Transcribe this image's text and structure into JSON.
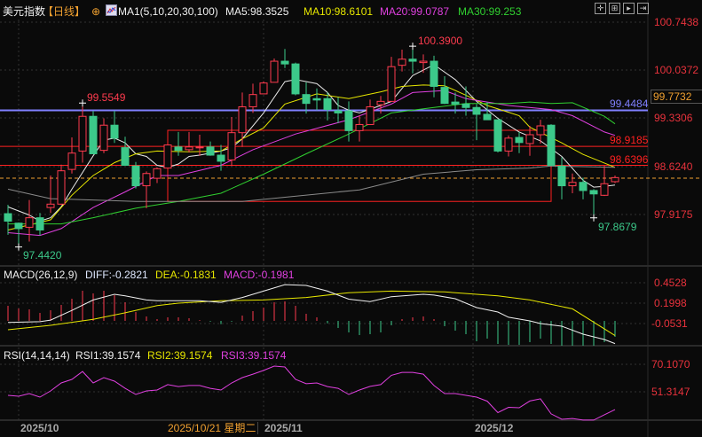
{
  "header": {
    "symbol": "美元指数",
    "period": "【日线】",
    "ma_params": "MA1(5,10,20,30,100)",
    "ma5": "MA5:98.3525",
    "ma10": "MA10:98.6101",
    "ma20": "MA20:99.0787",
    "ma30": "MA30:99.253"
  },
  "macd_header": {
    "params": "MACD(26,12,9)",
    "diff": "DIFF:-0.2821",
    "dea": "DEA:-0.1831",
    "macd": "MACD:-0.1981"
  },
  "rsi_header": {
    "params": "RSI(14,14,14)",
    "rsi1": "RSI1:39.1574",
    "rsi2": "RSI2:39.1574",
    "rsi3": "RSI3:39.1574"
  },
  "toolbar": {
    "icons": [
      "crosshair-icon",
      "zoom-in-icon",
      "play-icon",
      "move-right-icon"
    ]
  },
  "price_axis": [
    "100.7438",
    "100.0372",
    "99.3306",
    "98.6240",
    "97.9175"
  ],
  "crosshair_price": "99.7732",
  "crosshair_date": "2025/10/21 星期二",
  "macd_axis": [
    "0.4528",
    "0.1998",
    "-0.0531"
  ],
  "rsi_axis": [
    "70.1070",
    "51.3147"
  ],
  "date_axis": [
    "2025/10",
    "2025/11",
    "2025/12"
  ],
  "annotations": {
    "high": "100.3900",
    "local_high": "99.5549",
    "low": "97.4420",
    "recent_low": "97.8679"
  },
  "hlines": {
    "blue": "99.4484",
    "red1": "98.9185",
    "red2": "98.6396"
  },
  "colors": {
    "up": "#ff3b4e",
    "down": "#3cc98a",
    "ma5": "#e8e8e8",
    "ma10": "#e6e600",
    "ma20": "#e040e0",
    "ma30": "#30d030",
    "ma100": "#8a8a8a",
    "blue_line": "#8080ff",
    "axis_text": "#e8323c",
    "crosshair": "#f0a030"
  },
  "chart_data": {
    "type": "candlestick",
    "price_range": [
      97.9175,
      100.7438
    ],
    "candles": [
      [
        97.93,
        98.06,
        97.62,
        97.82
      ],
      [
        97.79,
        97.8,
        97.44,
        97.71
      ],
      [
        97.73,
        98.13,
        97.52,
        97.87
      ],
      [
        97.87,
        97.94,
        97.61,
        97.69
      ],
      [
        98.02,
        98.49,
        97.94,
        98.07
      ],
      [
        98.07,
        98.65,
        98.06,
        98.56
      ],
      [
        98.58,
        99.05,
        98.52,
        98.82
      ],
      [
        98.85,
        99.5549,
        98.68,
        99.36
      ],
      [
        99.36,
        99.44,
        98.81,
        98.81
      ],
      [
        98.86,
        99.33,
        98.82,
        99.23
      ],
      [
        99.23,
        99.44,
        98.97,
        99.04
      ],
      [
        98.9,
        99.06,
        98.64,
        98.64
      ],
      [
        98.63,
        98.69,
        98.3,
        98.34
      ],
      [
        98.34,
        98.55,
        98.01,
        98.52
      ],
      [
        98.45,
        98.61,
        98.38,
        98.59
      ],
      [
        98.6,
        98.94,
        98.6,
        98.94
      ],
      [
        98.91,
        99.13,
        98.78,
        98.86
      ],
      [
        98.87,
        99.13,
        98.83,
        98.91
      ],
      [
        98.9,
        99.09,
        98.78,
        98.91
      ],
      [
        98.91,
        98.99,
        98.78,
        98.79
      ],
      [
        98.79,
        98.94,
        98.56,
        98.7
      ],
      [
        98.72,
        99.35,
        98.63,
        99.12
      ],
      [
        99.12,
        99.71,
        98.91,
        99.5
      ],
      [
        99.5,
        99.84,
        99.41,
        99.68
      ],
      [
        99.69,
        99.875,
        99.69,
        99.85
      ],
      [
        99.86,
        100.21,
        99.86,
        100.17
      ],
      [
        100.17,
        100.35,
        100.07,
        100.13
      ],
      [
        100.13,
        100.15,
        99.67,
        99.69
      ],
      [
        99.68,
        99.86,
        99.4,
        99.55
      ],
      [
        99.62,
        99.77,
        99.45,
        99.6
      ],
      [
        99.62,
        99.71,
        99.3,
        99.46
      ],
      [
        99.44,
        99.64,
        99.26,
        99.41
      ],
      [
        99.44,
        99.58,
        98.99,
        99.15
      ],
      [
        99.15,
        99.37,
        98.99,
        99.24
      ],
      [
        99.24,
        99.605,
        99.24,
        99.5
      ],
      [
        99.53,
        99.66,
        99.4,
        99.58
      ],
      [
        99.58,
        100.235,
        99.58,
        100.09
      ],
      [
        100.11,
        100.34,
        100.02,
        100.2
      ],
      [
        100.2,
        100.39,
        99.99,
        100.17
      ],
      [
        100.15,
        100.27,
        100.0,
        100.17
      ],
      [
        100.17,
        100.25,
        99.64,
        99.8
      ],
      [
        99.785,
        99.95,
        99.54,
        99.55
      ],
      [
        99.57,
        99.71,
        99.4,
        99.54
      ],
      [
        99.54,
        99.8,
        99.37,
        99.49
      ],
      [
        99.49,
        99.54,
        99.01,
        99.39
      ],
      [
        99.39,
        99.57,
        99.31,
        99.31
      ],
      [
        99.31,
        99.31,
        98.83,
        98.85
      ],
      [
        98.85,
        99.08,
        98.77,
        99.04
      ],
      [
        99.05,
        99.13,
        98.82,
        98.975
      ],
      [
        98.96,
        99.22,
        98.78,
        99.09
      ],
      [
        99.09,
        99.31,
        98.96,
        99.22
      ],
      [
        99.23,
        99.245,
        98.64,
        98.64
      ],
      [
        98.63,
        98.76,
        98.14,
        98.34
      ],
      [
        98.34,
        98.52,
        98.23,
        98.39
      ],
      [
        98.39,
        98.46,
        98.14,
        98.27
      ],
      [
        98.27,
        98.29,
        97.8679,
        98.22
      ],
      [
        98.2,
        98.63,
        98.19,
        98.37
      ],
      [
        98.4,
        98.49,
        98.38,
        98.46
      ]
    ],
    "candle_fields": [
      "open",
      "high",
      "low",
      "close"
    ],
    "ma": [
      {
        "name": "MA5",
        "color": "#e8e8e8",
        "points": [
          [
            0,
            98.03
          ],
          [
            2,
            97.91
          ],
          [
            3,
            97.82
          ],
          [
            4,
            97.87
          ],
          [
            5,
            98.03
          ],
          [
            6,
            98.29
          ],
          [
            8,
            98.78
          ],
          [
            9,
            99.01
          ],
          [
            10,
            99.04
          ],
          [
            11,
            98.97
          ],
          [
            12,
            98.81
          ],
          [
            13,
            98.77
          ],
          [
            14,
            98.64
          ],
          [
            15,
            98.61
          ],
          [
            16,
            98.66
          ],
          [
            17,
            98.77
          ],
          [
            18,
            98.79
          ],
          [
            20,
            98.85
          ],
          [
            21,
            98.9
          ],
          [
            22,
            99.03
          ],
          [
            24,
            99.41
          ],
          [
            26,
            99.87
          ],
          [
            27,
            99.9
          ],
          [
            29,
            99.84
          ],
          [
            30,
            99.71
          ],
          [
            31,
            99.52
          ],
          [
            32,
            99.45
          ],
          [
            33,
            99.41
          ],
          [
            35,
            99.52
          ],
          [
            36,
            99.58
          ],
          [
            38,
            99.96
          ],
          [
            40,
            100.12
          ],
          [
            42,
            99.9
          ],
          [
            44,
            99.58
          ],
          [
            46,
            99.33
          ],
          [
            48,
            99.13
          ],
          [
            50,
            99.0
          ],
          [
            52,
            98.77
          ],
          [
            54,
            98.42
          ],
          [
            55,
            98.32
          ],
          [
            56,
            98.33
          ],
          [
            57,
            98.35
          ]
        ]
      },
      {
        "name": "MA10",
        "color": "#e6e600",
        "points": [
          [
            0,
            97.69
          ],
          [
            4,
            97.84
          ],
          [
            6,
            98.2
          ],
          [
            8,
            98.49
          ],
          [
            10,
            98.68
          ],
          [
            12,
            98.81
          ],
          [
            14,
            98.85
          ],
          [
            17,
            98.84
          ],
          [
            20,
            98.85
          ],
          [
            22,
            99.03
          ],
          [
            24,
            99.19
          ],
          [
            26,
            99.54
          ],
          [
            29,
            99.69
          ],
          [
            32,
            99.62
          ],
          [
            35,
            99.72
          ],
          [
            37,
            99.8
          ],
          [
            39,
            99.82
          ],
          [
            41,
            99.81
          ],
          [
            43,
            99.67
          ],
          [
            45,
            99.52
          ],
          [
            48,
            99.37
          ],
          [
            49,
            99.2
          ],
          [
            52,
            98.97
          ],
          [
            54,
            98.8
          ],
          [
            57,
            98.61
          ]
        ]
      },
      {
        "name": "MA20",
        "color": "#e040e0",
        "points": [
          [
            0,
            97.65
          ],
          [
            3,
            97.61
          ],
          [
            5,
            97.71
          ],
          [
            8,
            98.02
          ],
          [
            11,
            98.25
          ],
          [
            14,
            98.49
          ],
          [
            16,
            98.49
          ],
          [
            20,
            98.64
          ],
          [
            23,
            98.87
          ],
          [
            27,
            99.1
          ],
          [
            32,
            99.31
          ],
          [
            36,
            99.54
          ],
          [
            38,
            99.71
          ],
          [
            41,
            99.74
          ],
          [
            43,
            99.62
          ],
          [
            47,
            99.52
          ],
          [
            51,
            99.46
          ],
          [
            53,
            99.37
          ],
          [
            56,
            99.13
          ],
          [
            57,
            99.08
          ]
        ]
      },
      {
        "name": "MA30",
        "color": "#30d030",
        "points": [
          [
            0,
            97.78
          ],
          [
            5,
            97.78
          ],
          [
            8,
            97.87
          ],
          [
            12,
            98.01
          ],
          [
            16,
            98.11
          ],
          [
            20,
            98.23
          ],
          [
            24,
            98.51
          ],
          [
            28,
            98.81
          ],
          [
            32,
            99.1
          ],
          [
            36,
            99.41
          ],
          [
            40,
            99.49
          ],
          [
            43,
            99.55
          ],
          [
            47,
            99.55
          ],
          [
            49,
            99.57
          ],
          [
            51,
            99.55
          ],
          [
            53,
            99.56
          ],
          [
            56,
            99.36
          ],
          [
            57,
            99.25
          ]
        ]
      },
      {
        "name": "MA100",
        "color": "#8a8a8a",
        "points": [
          [
            0,
            98.29
          ],
          [
            4,
            98.15
          ],
          [
            12,
            98.11
          ],
          [
            22,
            98.11
          ],
          [
            33,
            98.28
          ],
          [
            39,
            98.51
          ],
          [
            44,
            98.575
          ],
          [
            49,
            98.6
          ],
          [
            51,
            98.63
          ],
          [
            57,
            98.61
          ]
        ]
      }
    ],
    "hlines": [
      99.4484,
      98.9185,
      98.6396
    ],
    "box": {
      "from_index": 15,
      "to_index": 51,
      "top": 99.155,
      "bottom": 98.11
    },
    "crosshair": {
      "index": 15,
      "price": 98.6
    },
    "macd": {
      "range": [
        -0.31,
        0.4528
      ],
      "hist": [
        0.187,
        0.154,
        0.143,
        0.099,
        0.132,
        0.198,
        0.275,
        0.374,
        0.341,
        0.374,
        0.319,
        0.231,
        0.11,
        0.055,
        0.022,
        0.044,
        0.044,
        0.033,
        0.01,
        -0.01,
        -0.04,
        -0.01,
        0.066,
        0.121,
        0.165,
        0.231,
        0.242,
        0.187,
        0.088,
        0.044,
        -0.03,
        -0.088,
        -0.143,
        -0.176,
        -0.165,
        -0.143,
        -0.055,
        0.022,
        0.044,
        0.055,
        0.022,
        -0.066,
        -0.121,
        -0.165,
        -0.253,
        -0.22,
        -0.286,
        -0.297,
        -0.297,
        -0.264,
        -0.22,
        -0.286,
        -0.308,
        -0.308,
        -0.308,
        -0.308,
        -0.264,
        -0.198
      ],
      "diff": [
        [
          0,
          -0.02
        ],
        [
          3,
          -0.01
        ],
        [
          4,
          0.01
        ],
        [
          6,
          0.13
        ],
        [
          8,
          0.26
        ],
        [
          10,
          0.33
        ],
        [
          11,
          0.31
        ],
        [
          13,
          0.26
        ],
        [
          14,
          0.25
        ],
        [
          16,
          0.25
        ],
        [
          18,
          0.25
        ],
        [
          20,
          0.23
        ],
        [
          22,
          0.29
        ],
        [
          24,
          0.37
        ],
        [
          26,
          0.45
        ],
        [
          28,
          0.44
        ],
        [
          30,
          0.37
        ],
        [
          32,
          0.27
        ],
        [
          34,
          0.24
        ],
        [
          36,
          0.3
        ],
        [
          39,
          0.33
        ],
        [
          40,
          0.32
        ],
        [
          42,
          0.275
        ],
        [
          44,
          0.165
        ],
        [
          46,
          0.11
        ],
        [
          47,
          0.045
        ],
        [
          49,
          0.0
        ],
        [
          50,
          -0.033
        ],
        [
          52,
          -0.066
        ],
        [
          54,
          -0.165
        ],
        [
          56,
          -0.231
        ],
        [
          57,
          -0.2821
        ]
      ],
      "dea": [
        [
          0,
          -0.11
        ],
        [
          4,
          -0.055
        ],
        [
          8,
          0.02
        ],
        [
          11,
          0.1
        ],
        [
          14,
          0.19
        ],
        [
          16,
          0.22
        ],
        [
          20,
          0.25
        ],
        [
          24,
          0.26
        ],
        [
          28,
          0.29
        ],
        [
          32,
          0.35
        ],
        [
          36,
          0.37
        ],
        [
          41,
          0.36
        ],
        [
          46,
          0.31
        ],
        [
          49,
          0.26
        ],
        [
          53,
          0.15
        ],
        [
          57,
          -0.1831
        ]
      ]
    },
    "rsi": {
      "values": [
        48.9,
        48.3,
        50.1,
        47.7,
        51.9,
        57.4,
        59.8,
        65.2,
        57.4,
        61.0,
        58.6,
        53.7,
        49.5,
        51.9,
        52.5,
        56.2,
        54.9,
        55.6,
        55.6,
        53.7,
        52.5,
        57.4,
        61.0,
        63.4,
        65.9,
        68.9,
        68.3,
        59.8,
        56.8,
        57.4,
        54.9,
        53.7,
        49.5,
        52.5,
        55.0,
        56.2,
        62.6,
        64.6,
        64.6,
        63.4,
        55.6,
        50.1,
        50.1,
        48.9,
        47.7,
        44.9,
        37.1,
        40.7,
        40.4,
        45.0,
        46.5,
        36.2,
        32.5,
        33.1,
        32.0,
        32.0,
        35.6,
        39.1574
      ]
    }
  }
}
